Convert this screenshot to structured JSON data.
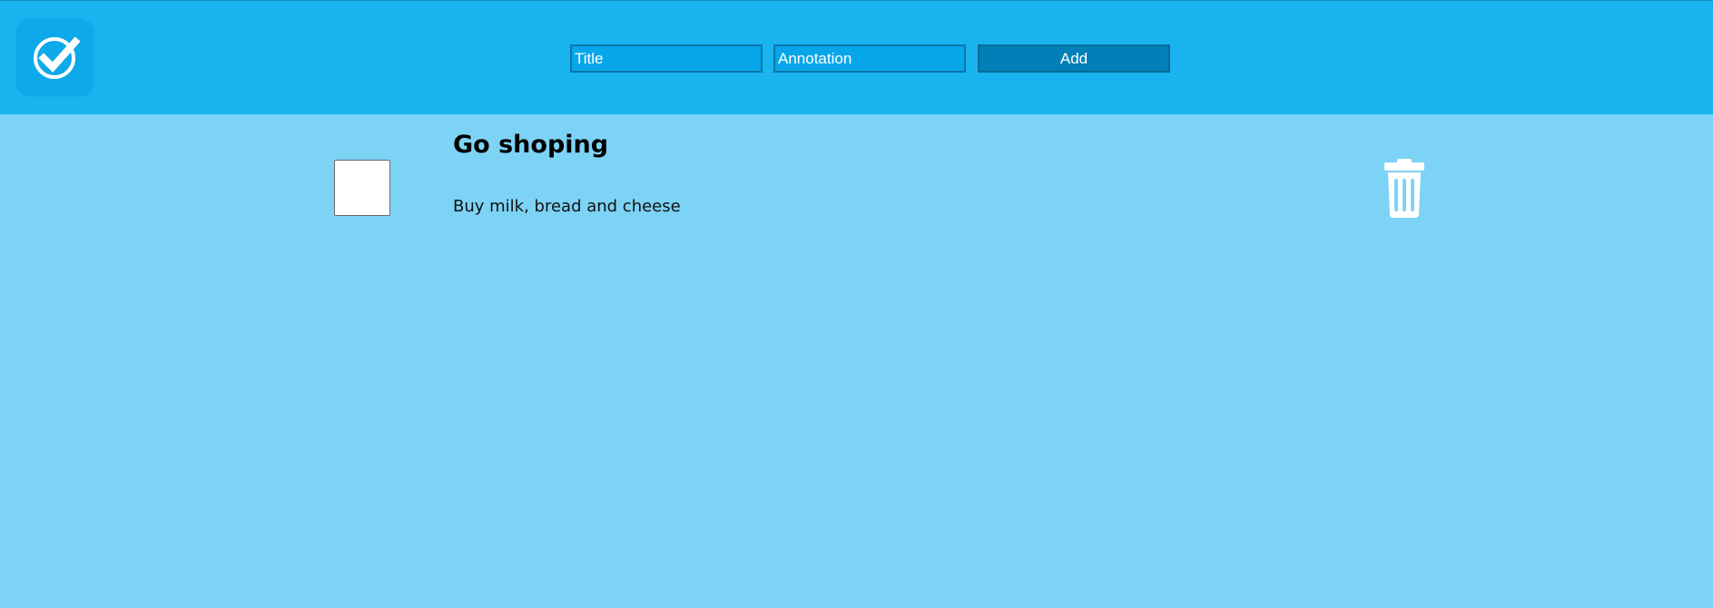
{
  "colors": {
    "header_bg": "#19b4ef",
    "page_bg": "#7dd3f5",
    "input_bg": "#07a6ea",
    "button_bg": "#0080b6",
    "logo_bg": "#0ea9e8"
  },
  "header": {
    "logo_icon": "checkmark-circle-icon",
    "title_placeholder": "Title",
    "annotation_placeholder": "Annotation",
    "add_label": "Add"
  },
  "tasks": [
    {
      "title": "Go shoping",
      "annotation": "Buy milk, bread and cheese",
      "completed": false,
      "delete_icon": "trash-icon"
    }
  ]
}
